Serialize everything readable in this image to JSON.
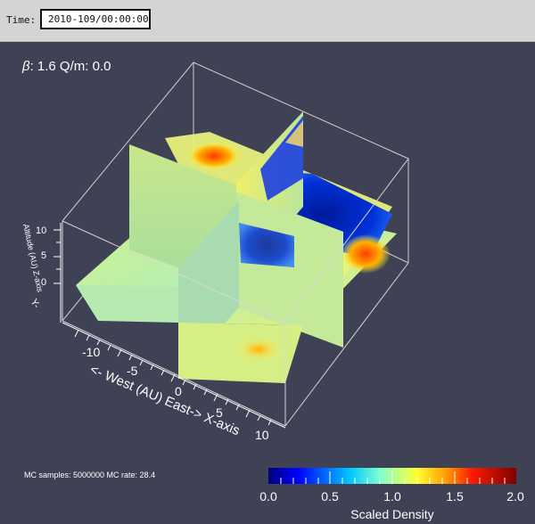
{
  "toolbar": {
    "time_label": "Time:",
    "time_value": "2010-109/00:00:00"
  },
  "overlay": {
    "beta_symbol": "β",
    "beta_text": ": 1.6  Q/m: 0.0"
  },
  "axes": {
    "x_title": "<- West (AU) East-> X-axis",
    "x_ticks": [
      "-10",
      "-5",
      "0",
      "5",
      "10"
    ],
    "z_title": "Altitude (AU) Z-axis",
    "z_ticks": [
      "10",
      "5",
      "0"
    ],
    "y_title": "Y-"
  },
  "stats": {
    "mc_text": "MC samples: 5000000  MC rate: 28.4"
  },
  "colorbar": {
    "title": "Scaled Density",
    "ticks": [
      "0.0",
      "0.5",
      "1.0",
      "1.5",
      "2.0"
    ],
    "range": [
      0.0,
      2.0
    ],
    "colors": [
      "#00007f",
      "#0000ff",
      "#00bfff",
      "#7fffcf",
      "#ffff00",
      "#ff7f00",
      "#ff0000",
      "#7f0000"
    ]
  }
}
